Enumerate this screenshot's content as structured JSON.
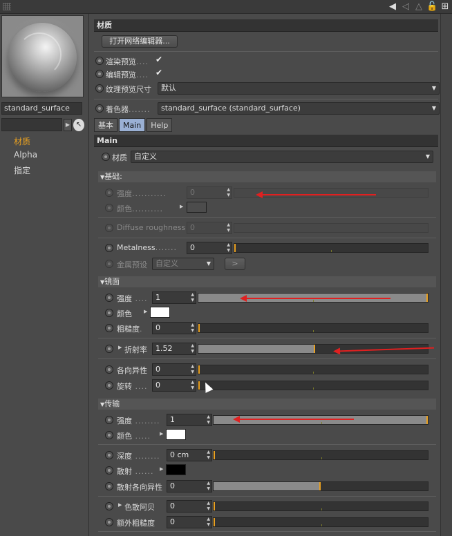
{
  "left": {
    "material_name": "standard_surface",
    "nav": [
      "材质",
      "Alpha",
      "指定"
    ]
  },
  "top": {
    "section_title": "材质",
    "open_node_editor": "打开网络编辑器...",
    "render_preview_label": "渲染预览",
    "editor_preview_label": "编辑预览",
    "texture_preview_size_label": "纹理预览尺寸",
    "texture_preview_size_value": "默认",
    "shader_label": "着色器",
    "shader_value": "standard_surface (standard_surface)",
    "checkmark": "✔"
  },
  "tabs": [
    "基本",
    "Main",
    "Help"
  ],
  "main": {
    "title": "Main",
    "material_label": "材质",
    "material_value": "自定义",
    "base": {
      "title": "基础:",
      "strength_label": "强度",
      "strength_value": "0",
      "color_label": "颜色",
      "diffuse_label": "Diffuse roughness",
      "diffuse_value": "0",
      "metalness_label": "Metalness",
      "metalness_value": "0",
      "metal_preset_label": "金属预设",
      "metal_preset_value": "自定义",
      "metal_preset_btn": ">"
    },
    "specular": {
      "title": "镜面",
      "strength_label": "强度",
      "strength_value": "1",
      "strength_fraction": 1.0,
      "color_label": "颜色",
      "color": "#ffffff",
      "roughness_label": "粗糙度",
      "roughness_value": "0",
      "ior_label": "折射率",
      "ior_value": "1.52",
      "ior_fraction": 0.51,
      "aniso_label": "各向异性",
      "aniso_value": "0",
      "rotation_label": "旋转",
      "rotation_value": "0"
    },
    "transmission": {
      "title": "传输",
      "strength_label": "强度",
      "strength_value": "1",
      "strength_fraction": 1.0,
      "color_label": "颜色",
      "color": "#ffffff",
      "depth_label": "深度",
      "depth_value": "0 cm",
      "scatter_label": "散射",
      "scatter_color": "#000000",
      "scatter_aniso_label": "散射各向异性",
      "scatter_aniso_value": "0",
      "scatter_aniso_fraction": 0.5,
      "dispersion_label": "色散阿贝",
      "dispersion_value": "0",
      "extra_rough_label": "额外粗糙度",
      "extra_rough_value": "0"
    }
  },
  "colors": {
    "annotation_arrow": "#e02020",
    "slider_knob": "#e8a020",
    "active_tab": "#9ab0d4"
  }
}
